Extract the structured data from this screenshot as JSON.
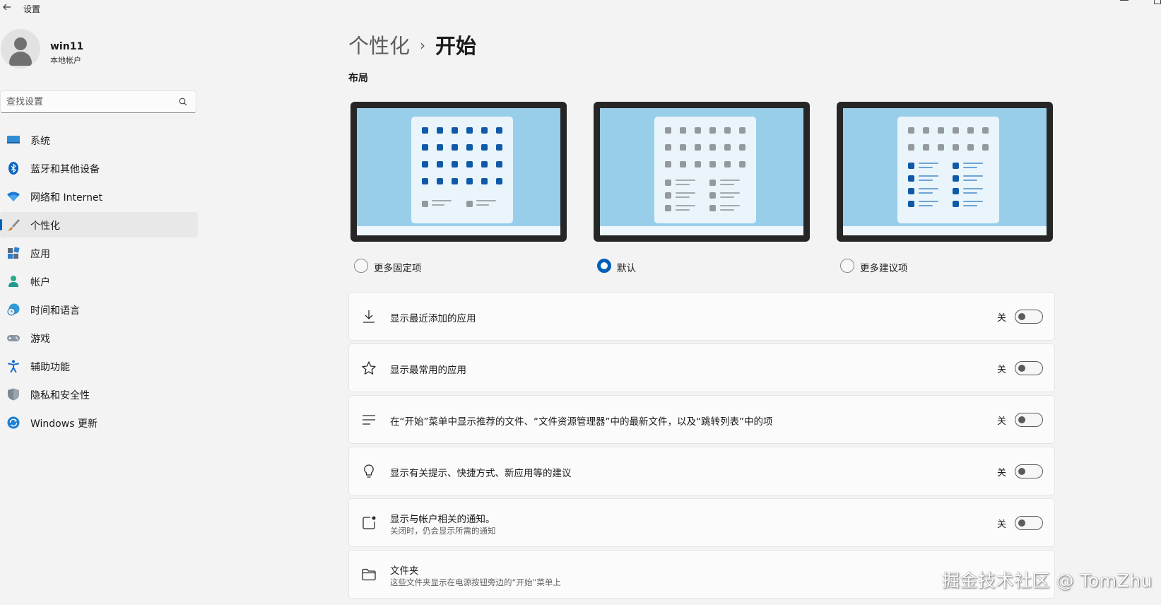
{
  "window": {
    "title": "设置"
  },
  "profile": {
    "name": "win11",
    "account_type": "本地帐户"
  },
  "search": {
    "placeholder": "查找设置"
  },
  "sidebar": {
    "accent_color": "#005fb8",
    "items": [
      {
        "label": "系统",
        "icon": "display-icon",
        "active": false
      },
      {
        "label": "蓝牙和其他设备",
        "icon": "bluetooth-icon",
        "active": false
      },
      {
        "label": "网络和 Internet",
        "icon": "wifi-icon",
        "active": false
      },
      {
        "label": "个性化",
        "icon": "paintbrush-icon",
        "active": true
      },
      {
        "label": "应用",
        "icon": "apps-icon",
        "active": false
      },
      {
        "label": "帐户",
        "icon": "person-icon",
        "active": false
      },
      {
        "label": "时间和语言",
        "icon": "globe-clock-icon",
        "active": false
      },
      {
        "label": "游戏",
        "icon": "gamepad-icon",
        "active": false
      },
      {
        "label": "辅助功能",
        "icon": "accessibility-icon",
        "active": false
      },
      {
        "label": "隐私和安全性",
        "icon": "shield-icon",
        "active": false
      },
      {
        "label": "Windows 更新",
        "icon": "update-icon",
        "active": false
      }
    ]
  },
  "breadcrumb": {
    "parent": "个性化",
    "separator": "›",
    "current": "开始"
  },
  "layout_section": {
    "title": "布局",
    "options": [
      {
        "label": "更多固定项",
        "selected": false
      },
      {
        "label": "默认",
        "selected": true
      },
      {
        "label": "更多建议项",
        "selected": false
      }
    ]
  },
  "settings": [
    {
      "icon": "download-icon",
      "title": "显示最近添加的应用",
      "subtitle": "",
      "state": "关",
      "on": false
    },
    {
      "icon": "star-icon",
      "title": "显示最常用的应用",
      "subtitle": "",
      "state": "关",
      "on": false
    },
    {
      "icon": "list-icon",
      "title": "在“开始”菜单中显示推荐的文件、“文件资源管理器”中的最新文件，以及“跳转列表”中的项",
      "subtitle": "",
      "state": "关",
      "on": false
    },
    {
      "icon": "lightbulb-icon",
      "title": "显示有关提示、快捷方式、新应用等的建议",
      "subtitle": "",
      "state": "关",
      "on": false
    },
    {
      "icon": "notification-icon",
      "title": "显示与帐户相关的通知。",
      "subtitle": "关闭时，仍会显示所需的通知",
      "state": "关",
      "on": false
    },
    {
      "icon": "folder-icon",
      "title": "文件夹",
      "subtitle": "这些文件夹显示在电源按钮旁边的“开始”菜单上",
      "state": "",
      "on": null
    }
  ],
  "watermark": "掘金技术社区 @ TomZhu"
}
